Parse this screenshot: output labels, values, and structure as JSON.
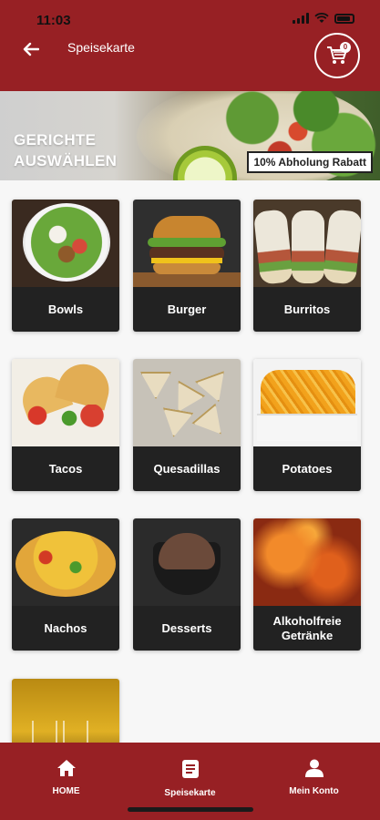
{
  "status_bar": {
    "time": "11:03"
  },
  "header": {
    "title": "Speisekarte",
    "cart_count": "0"
  },
  "hero": {
    "title_line1": "GERICHTE",
    "title_line2": "AUSWÄHLEN",
    "badge": "10% Abholung Rabatt"
  },
  "categories": [
    {
      "label": "Bowls"
    },
    {
      "label": "Burger"
    },
    {
      "label": "Burritos"
    },
    {
      "label": "Tacos"
    },
    {
      "label": "Quesadillas"
    },
    {
      "label": "Potatoes"
    },
    {
      "label": "Nachos"
    },
    {
      "label": "Desserts"
    },
    {
      "label": "Alkoholfreie Getränke"
    },
    {
      "label": ""
    }
  ],
  "bottom_nav": [
    {
      "label": "HOME",
      "icon": "home-icon"
    },
    {
      "label": "Speisekarte",
      "icon": "menu-icon"
    },
    {
      "label": "Mein Konto",
      "icon": "person-icon"
    }
  ],
  "colors": {
    "brand": "#972024",
    "card_label": "#222222"
  }
}
